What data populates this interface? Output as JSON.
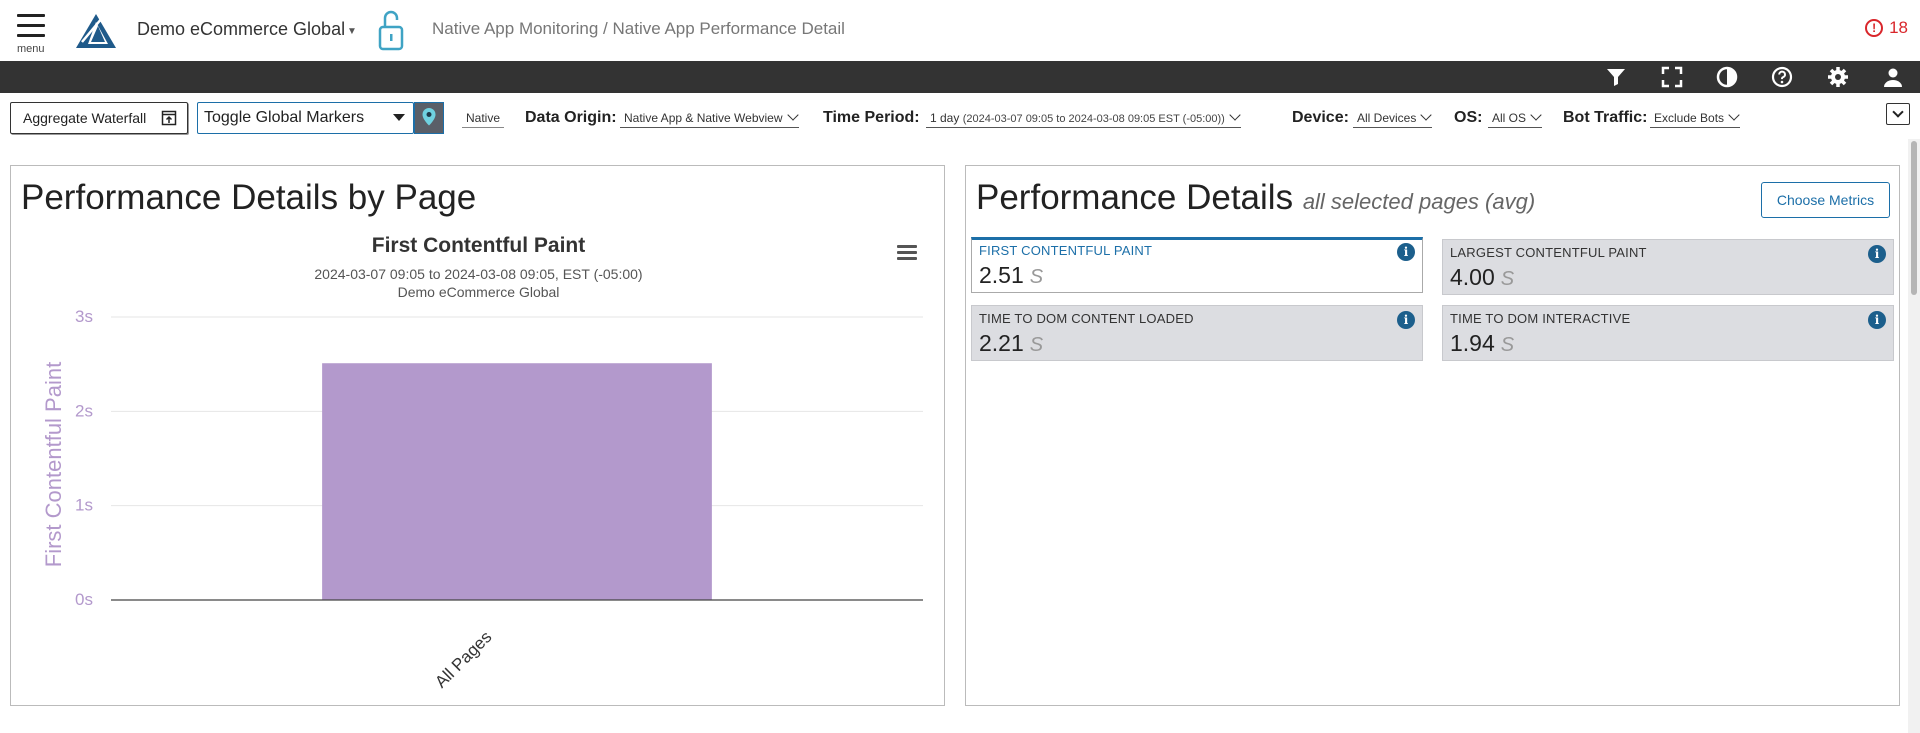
{
  "header": {
    "menu_label": "menu",
    "app_name": "Demo eCommerce Global",
    "breadcrumb": "Native App Monitoring / Native App Performance Detail",
    "alert_count": "18"
  },
  "filters": {
    "waterfall_button": "Aggregate Waterfall",
    "markers_select": "Toggle Global Markers",
    "platform_tag": "Native",
    "data_origin_label": "Data Origin:",
    "data_origin_value": "Native App & Native Webview",
    "time_period_label": "Time Period:",
    "time_period_value": "1 day",
    "time_period_range": "(2024-03-07 09:05 to 2024-03-08 09:05 EST (-05:00))",
    "device_label": "Device:",
    "device_value": "All Devices",
    "os_label": "OS:",
    "os_value": "All OS",
    "bot_label": "Bot Traffic:",
    "bot_value": "Exclude Bots"
  },
  "left_panel": {
    "title": "Performance Details by Page"
  },
  "chart_data": {
    "type": "bar",
    "title": "First Contentful Paint",
    "subtitle_line1": "2024-03-07 09:05 to 2024-03-08 09:05, EST (-05:00)",
    "subtitle_line2": "Demo eCommerce Global",
    "ylabel": "First Contentful Paint",
    "xlabel": "",
    "categories": [
      "All Pages"
    ],
    "values": [
      2.51
    ],
    "ylim": [
      0,
      3
    ],
    "y_ticks": [
      0,
      1,
      2,
      3
    ],
    "y_tick_labels": [
      "0s",
      "1s",
      "2s",
      "3s"
    ],
    "grid": true,
    "bar_color": "#b399cc",
    "axis_label_color": "#b399cc"
  },
  "right_panel": {
    "title": "Performance Details",
    "subtitle": "all selected pages (avg)",
    "choose_metrics": "Choose Metrics",
    "metrics": [
      {
        "label": "First Contentful Paint",
        "value": "2.51",
        "unit": "S",
        "active": true
      },
      {
        "label": "Largest Contentful Paint",
        "value": "4.00",
        "unit": "S",
        "active": false
      },
      {
        "label": "Time to DOM Content Loaded",
        "value": "2.21",
        "unit": "S",
        "active": false
      },
      {
        "label": "Time to DOM Interactive",
        "value": "1.94",
        "unit": "S",
        "active": false
      }
    ]
  },
  "colors": {
    "accent": "#1c6fa8",
    "toolbar_bg": "#333333",
    "alert": "#d9262b",
    "metric_card_bg": "#dcdde1"
  }
}
